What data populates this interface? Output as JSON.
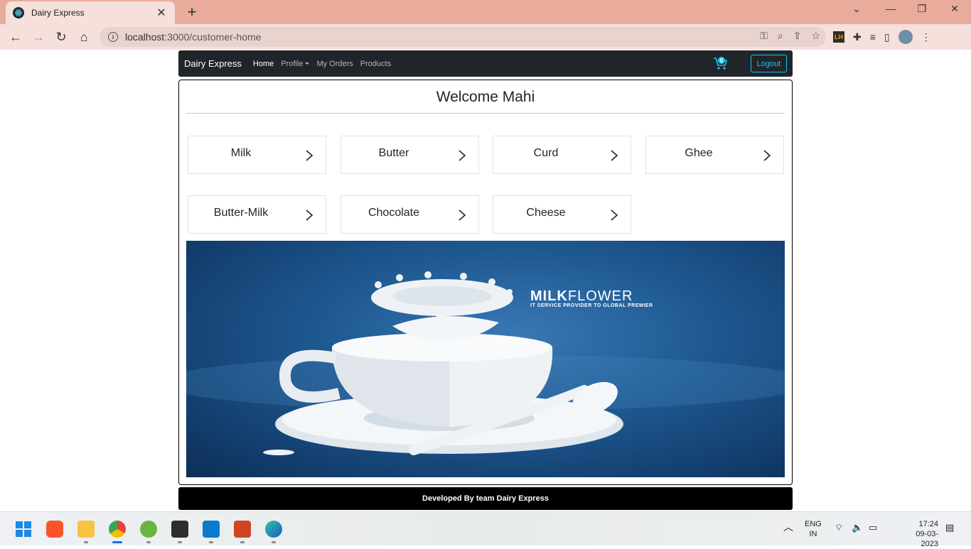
{
  "browser": {
    "tab_title": "Dairy Express",
    "url_host": "localhost",
    "url_path": ":3000/customer-home"
  },
  "navbar": {
    "brand": "Dairy Express",
    "links": [
      "Home",
      "Profile",
      "My Orders",
      "Products"
    ],
    "cart_count": "0",
    "logout_label": "Logout"
  },
  "main": {
    "welcome": "Welcome Mahi",
    "categories": [
      "Milk",
      "Butter",
      "Curd",
      "Ghee",
      "Butter-Milk",
      "Chocolate",
      "Cheese"
    ]
  },
  "banner": {
    "brand_bold": "MILK",
    "brand_light": "FLOWER",
    "tagline": "IT SERVICE PROVIDER TO GLOBAL PREMIER"
  },
  "footer": {
    "text": "Developed By team Dairy Express"
  },
  "taskbar": {
    "lang_line1": "ENG",
    "lang_line2": "IN",
    "time": "17:24",
    "date": "09-03-2023"
  }
}
